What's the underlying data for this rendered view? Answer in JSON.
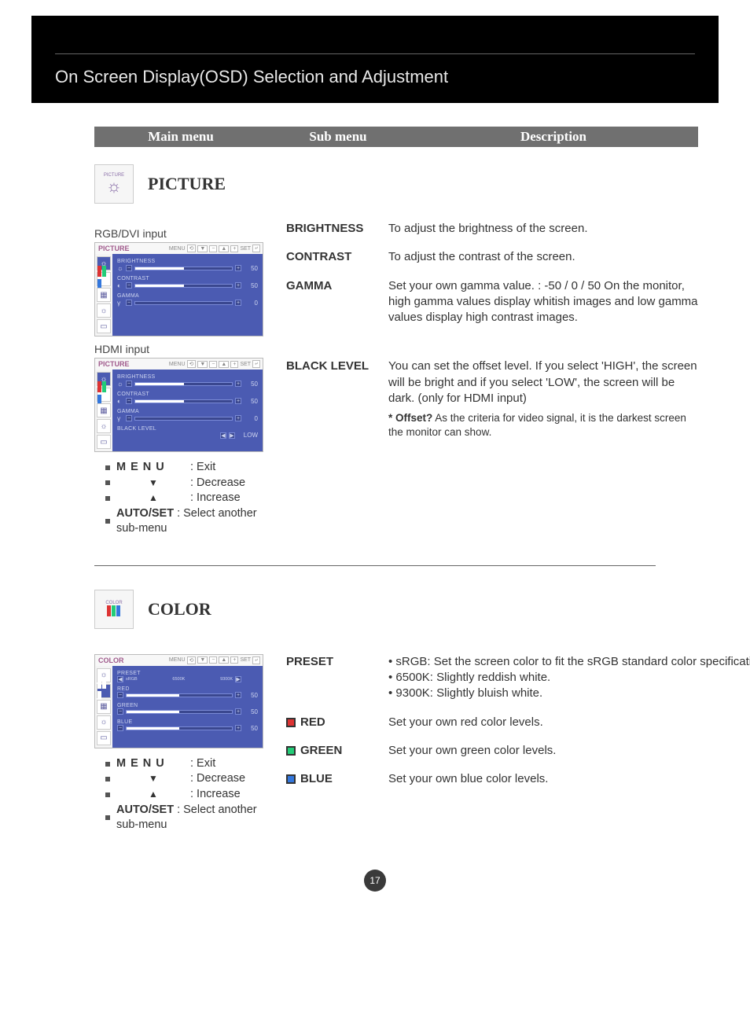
{
  "header": {
    "title": "On Screen Display(OSD) Selection and Adjustment"
  },
  "columns": {
    "main": "Main menu",
    "sub": "Sub menu",
    "desc": "Description"
  },
  "picture": {
    "title": "PICTURE",
    "icon_label": "PICTURE",
    "inputs": {
      "rgb": "RGB/DVI input",
      "hdmi": "HDMI input"
    },
    "osd": {
      "title": "PICTURE",
      "btns": {
        "menu": "MENU",
        "set": "SET"
      },
      "rows_rgb": [
        {
          "label": "BRIGHTNESS",
          "value": "50"
        },
        {
          "label": "CONTRAST",
          "value": "50"
        },
        {
          "label": "GAMMA",
          "value": "0"
        }
      ],
      "rows_hdmi": [
        {
          "label": "BRIGHTNESS",
          "value": "50"
        },
        {
          "label": "CONTRAST",
          "value": "50"
        },
        {
          "label": "GAMMA",
          "value": "0"
        },
        {
          "label": "BLACK LEVEL",
          "value": "LOW"
        }
      ]
    },
    "items": [
      {
        "label": "BRIGHTNESS",
        "desc": "To adjust the brightness of the screen."
      },
      {
        "label": "CONTRAST",
        "desc": "To adjust the contrast of the screen."
      },
      {
        "label": "GAMMA",
        "desc": "Set your own gamma value. : -50 / 0 / 50 On the monitor, high gamma values display whitish images and low gamma values display high contrast images."
      },
      {
        "label": "BLACK LEVEL",
        "desc": "You can set the offset level. If you select 'HIGH', the screen will be bright and if you select 'LOW', the screen will be dark. (only for HDMI input)"
      }
    ],
    "offset_note": {
      "label": "* Offset?",
      "text": " As the criteria for video signal, it is the darkest screen the monitor can show."
    }
  },
  "legend": {
    "menu_key": "M E N U",
    "menu_desc": ": Exit",
    "down_desc": ": Decrease",
    "up_desc": ": Increase",
    "autoset_key": "AUTO/SET",
    "autoset_desc": " : Select another sub-menu"
  },
  "color": {
    "title": "COLOR",
    "icon_label": "COLOR",
    "osd": {
      "title": "COLOR",
      "rows": [
        {
          "label": "PRESET",
          "value": ""
        },
        {
          "label": "RED",
          "value": "50"
        },
        {
          "label": "GREEN",
          "value": "50"
        },
        {
          "label": "BLUE",
          "value": "50"
        }
      ],
      "preset_opts": {
        "a": "sRGB",
        "b": "6500K",
        "c": "9300K"
      }
    },
    "items": {
      "preset": {
        "label": "PRESET",
        "bullets": [
          "• sRGB: Set the screen color to fit the sRGB standard color specification.",
          "• 6500K: Slightly reddish white.",
          "• 9300K: Slightly bluish white."
        ]
      },
      "red": {
        "label": "RED",
        "desc": "Set your own red color levels."
      },
      "green": {
        "label": "GREEN",
        "desc": "Set your own green color levels."
      },
      "blue": {
        "label": "BLUE",
        "desc": "Set your own blue color levels."
      }
    }
  },
  "page_number": "17"
}
